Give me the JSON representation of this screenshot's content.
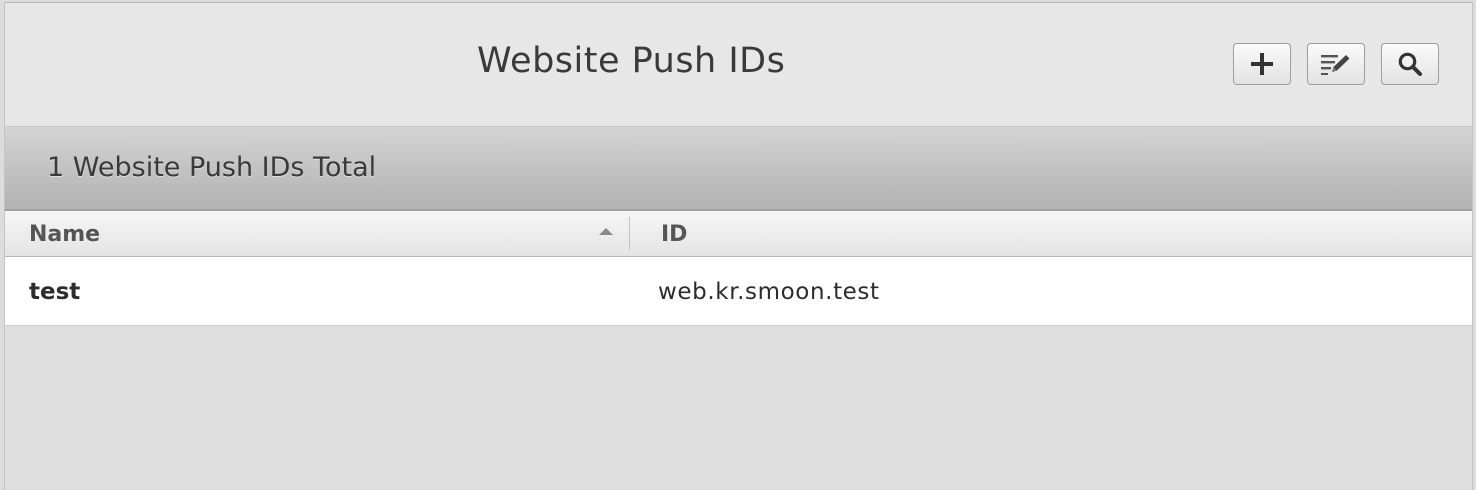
{
  "header": {
    "title": "Website Push IDs",
    "toolbar": [
      {
        "name": "add",
        "icon": "plus-icon"
      },
      {
        "name": "edit",
        "icon": "edit-list-icon"
      },
      {
        "name": "search",
        "icon": "search-icon"
      }
    ]
  },
  "summary": {
    "count_text": "1 Website Push IDs Total"
  },
  "table": {
    "columns": [
      "Name",
      "ID"
    ],
    "sort": {
      "column": "Name",
      "direction": "ascending"
    },
    "rows": [
      {
        "name": "test",
        "id": "web.kr.smoon.test"
      }
    ]
  }
}
